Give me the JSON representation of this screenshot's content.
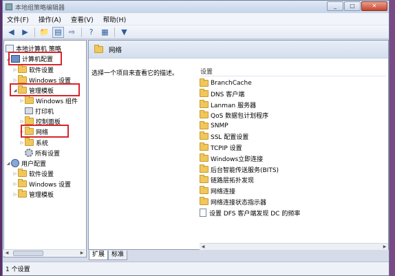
{
  "window": {
    "title": "本地组策略编辑器"
  },
  "menu": [
    "文件(F)",
    "操作(A)",
    "查看(V)",
    "帮助(H)"
  ],
  "toolbar": {
    "buttons": [
      "back-icon",
      "forward-icon",
      "up-folder-icon",
      "show-hide-tree-icon",
      "export-icon",
      "help-icon",
      "properties-icon",
      "filter-icon"
    ]
  },
  "tree": {
    "root": "本地计算机 策略",
    "computer_config": "计算机配置",
    "software_settings": "软件设置",
    "windows_settings": "Windows 设置",
    "admin_templates": "管理模板",
    "windows_components": "Windows 组件",
    "printers": "打印机",
    "control_panel": "控制面板",
    "network": "网络",
    "system": "系统",
    "all_settings": "所有设置",
    "user_config": "用户配置",
    "user_software_settings": "软件设置",
    "user_windows_settings": "Windows 设置",
    "user_admin_templates": "管理模板"
  },
  "right_pane": {
    "header": "网络",
    "description": "选择一个项目来查看它的描述。",
    "column_header": "设置",
    "items": [
      "BranchCache",
      "DNS 客户端",
      "Lanman 服务器",
      "QoS 数据包计划程序",
      "SNMP",
      "SSL 配置设置",
      "TCPIP 设置",
      "Windows立即连接",
      "后台智能传送服务(BITS)",
      "链路层拓扑发现",
      "网络连接",
      "网络连接状态指示器"
    ],
    "setting_item": "设置 DFS 客户端发现 DC 的频率"
  },
  "tabs": [
    "扩展",
    "标准"
  ],
  "status": "1 个设置"
}
